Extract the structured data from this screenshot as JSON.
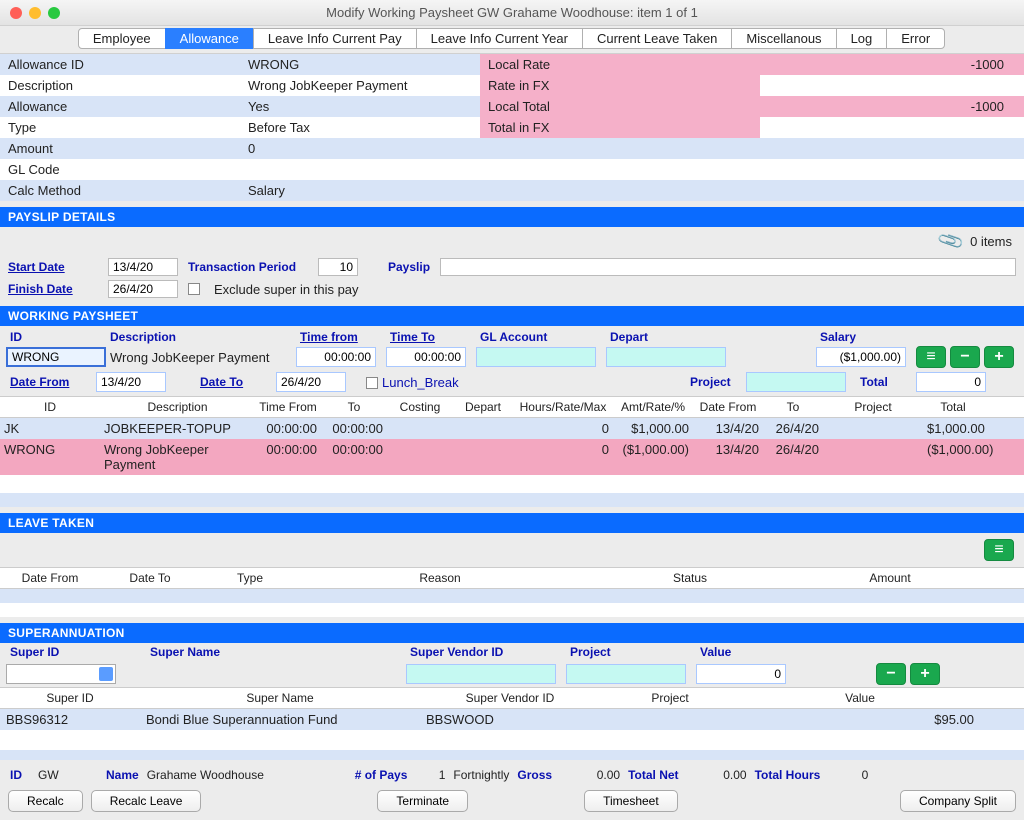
{
  "window": {
    "title": "Modify Working Paysheet GW Grahame Woodhouse: item 1  of  1"
  },
  "tabs": [
    "Employee",
    "Allowance",
    "Leave Info Current Pay",
    "Leave Info Current Year",
    "Current Leave Taken",
    "Miscellanous",
    "Log",
    "Error"
  ],
  "active_tab": 1,
  "allowance_fields": {
    "Allowance ID": "WRONG",
    "Description": "Wrong JobKeeper Payment",
    "Allowance": "Yes",
    "Type": "Before Tax",
    "Amount": "0",
    "GL Code": "",
    "Calc Method": "Salary"
  },
  "fx_fields": {
    "Local Rate": "-1000",
    "Rate in FX": "",
    "Local Total": "-1000",
    "Total in FX": ""
  },
  "sections": {
    "payslip": "PAYSLIP DETAILS",
    "working": "WORKING PAYSHEET",
    "leave": "LEAVE TAKEN",
    "super": "SUPERANNUATION"
  },
  "attach": {
    "items_text": "0 items"
  },
  "payslip": {
    "start_label": "Start Date",
    "start": "13/4/20",
    "finish_label": "Finish Date",
    "finish": "26/4/20",
    "trans_label": "Transaction Period",
    "trans": "10",
    "payslip_label": "Payslip",
    "exclude_label": "Exclude super in this pay"
  },
  "ws": {
    "hdr": {
      "id": "ID",
      "desc": "Description",
      "tfrom": "Time from",
      "tto": "Time To",
      "gl": "GL Account",
      "depart": "Depart",
      "salary": "Salary",
      "dfrom": "Date From",
      "dto": "Date To",
      "lunch": "Lunch_Break",
      "project": "Project",
      "total": "Total"
    },
    "vals": {
      "id": "WRONG",
      "desc": "Wrong JobKeeper Payment",
      "tfrom": "00:00:00",
      "tto": "00:00:00",
      "gl": "",
      "depart": "",
      "salary": "($1,000.00)",
      "dfrom": "13/4/20",
      "dto": "26/4/20",
      "project": "",
      "total": "0"
    },
    "cols": [
      "ID",
      "Description",
      "Time From",
      "To",
      "Costing",
      "Depart",
      "Hours/Rate/Max",
      "Amt/Rate/%",
      "Date From",
      "To",
      "Project",
      "Total"
    ],
    "rows": [
      {
        "id": "JK",
        "desc": "JOBKEEPER-TOPUP",
        "tf": "00:00:00",
        "tt": "00:00:00",
        "cost": "",
        "dep": "",
        "hrm": "0",
        "amt": "$1,000.00",
        "df": "13/4/20",
        "dt": "26/4/20",
        "proj": "",
        "tot": "$1,000.00"
      },
      {
        "id": "WRONG",
        "desc": "Wrong JobKeeper Payment",
        "tf": "00:00:00",
        "tt": "00:00:00",
        "cost": "",
        "dep": "",
        "hrm": "0",
        "amt": "($1,000.00)",
        "df": "13/4/20",
        "dt": "26/4/20",
        "proj": "",
        "tot": "($1,000.00)"
      }
    ]
  },
  "leave_cols": [
    "Date From",
    "Date To",
    "Type",
    "Reason",
    "Status",
    "Amount"
  ],
  "super": {
    "hdr": {
      "sid": "Super ID",
      "sname": "Super Name",
      "svid": "Super Vendor ID",
      "proj": "Project",
      "val": "Value"
    },
    "vals": {
      "val": "0"
    },
    "cols": [
      "Super ID",
      "Super Name",
      "Super Vendor ID",
      "Project",
      "Value"
    ],
    "rows": [
      {
        "sid": "BBS96312",
        "sname": "Bondi Blue Superannuation Fund",
        "svid": "BBSWOOD",
        "proj": "",
        "val": "$95.00"
      }
    ]
  },
  "footer": {
    "id_l": "ID",
    "id_v": "GW",
    "name_l": "Name",
    "name_v": "Grahame Woodhouse",
    "pays_l": "# of Pays",
    "pays_v": "1",
    "freq": "Fortnightly",
    "gross_l": "Gross",
    "gross_v": "0.00",
    "net_l": "Total Net",
    "net_v": "0.00",
    "hrs_l": "Total Hours",
    "hrs_v": "0",
    "btns": [
      "Recalc",
      "Recalc Leave",
      "Terminate",
      "Timesheet",
      "Company Split"
    ]
  },
  "icons": {
    "list": "≡",
    "minus": "−",
    "plus": "+"
  }
}
